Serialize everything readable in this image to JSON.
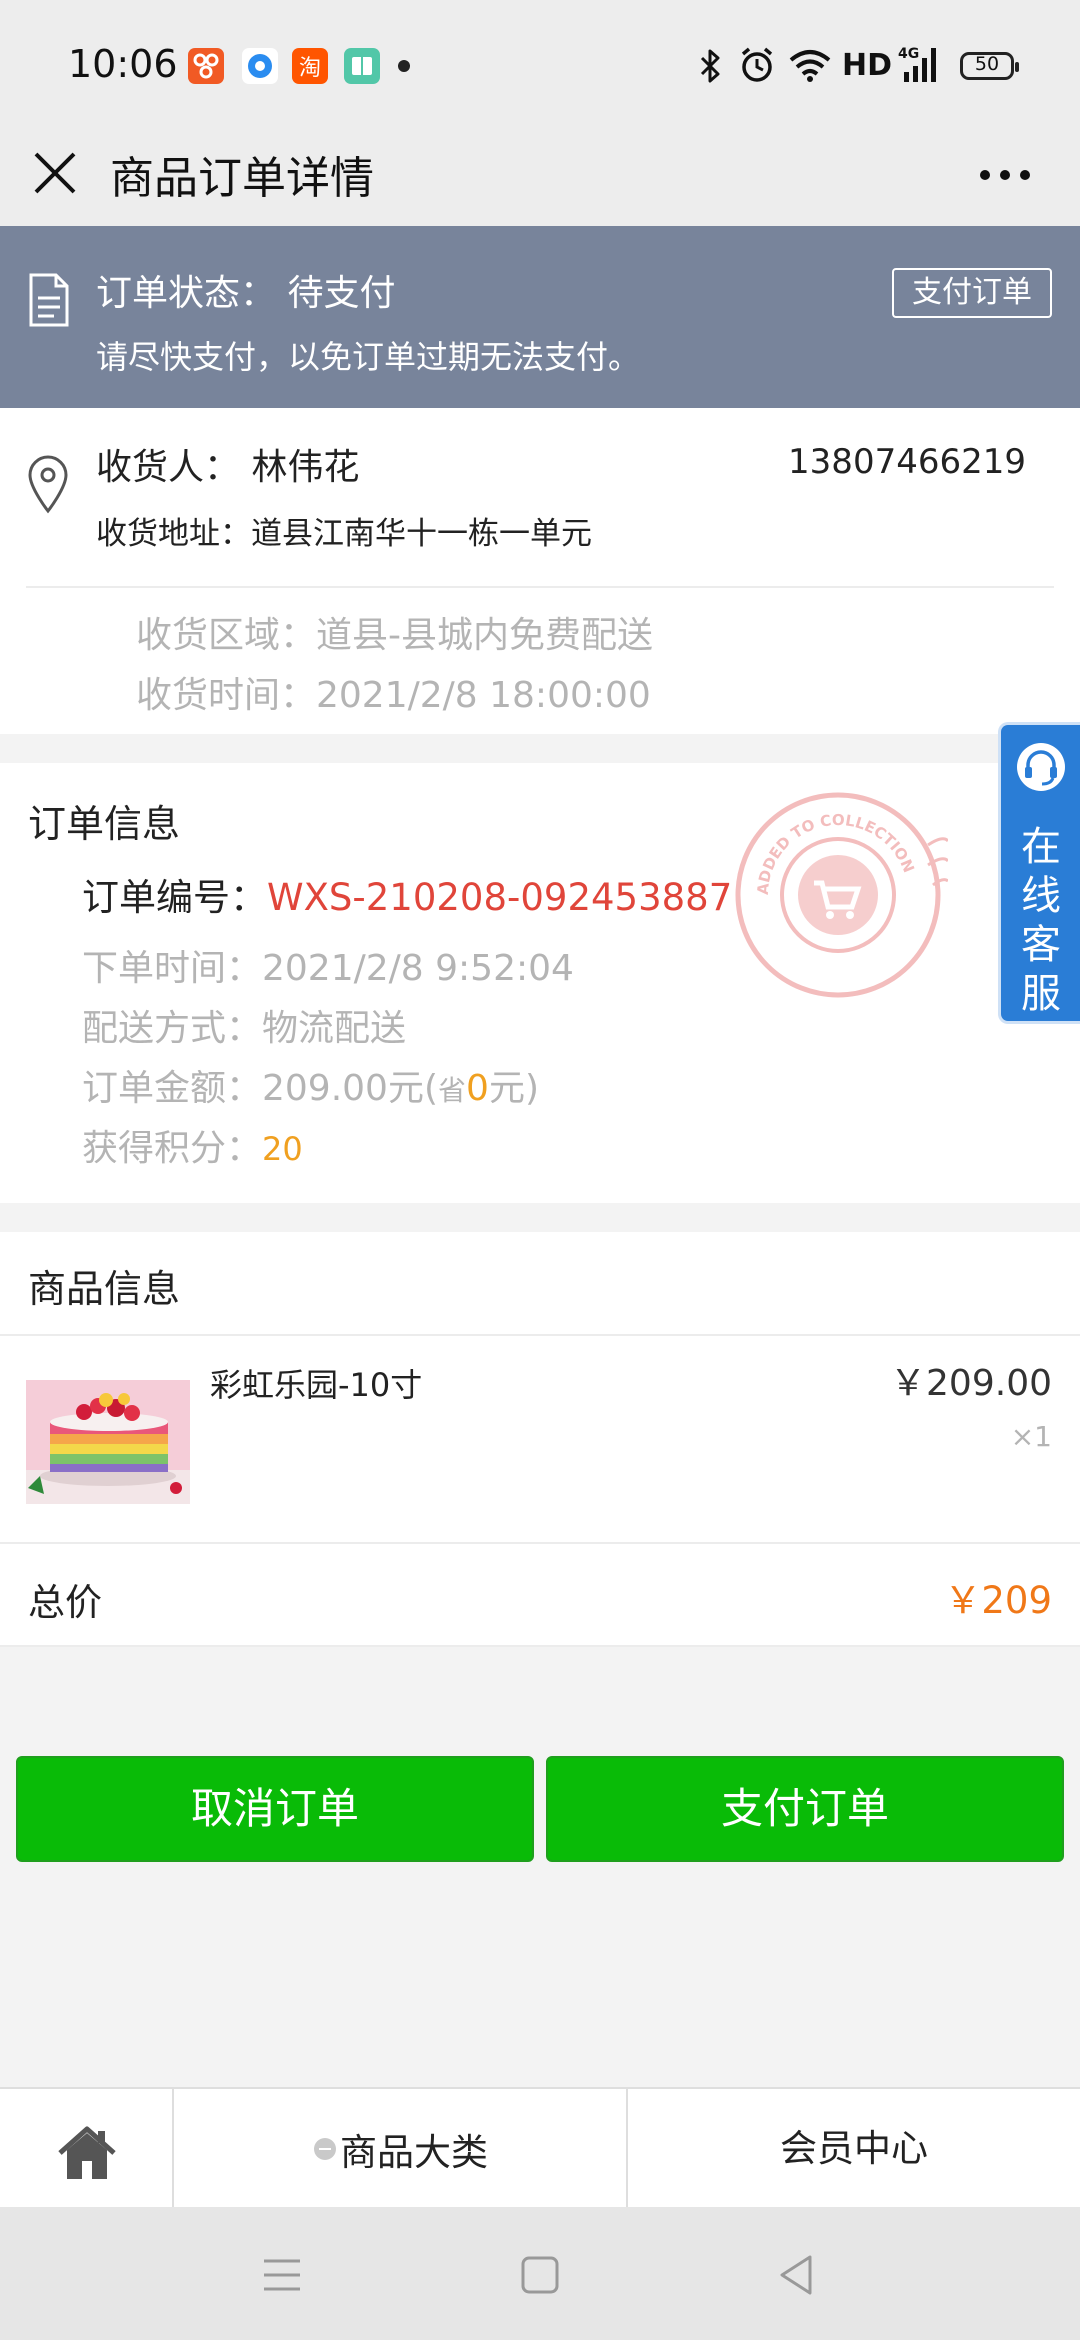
{
  "status_bar": {
    "time": "10:06",
    "network": "HD",
    "battery": "50",
    "icons": [
      "app-icon-red",
      "app-icon-blue",
      "taobao-icon",
      "reader-icon",
      "bluetooth-icon",
      "alarm-icon",
      "wifi-icon",
      "signal-4g-icon"
    ]
  },
  "header": {
    "title": "商品订单详情"
  },
  "order_status": {
    "status": "订单状态： 待支付",
    "tip": "请尽快支付，以免订单过期无法支付。",
    "pay_button": "支付订单"
  },
  "address": {
    "receiver": "收货人： 林伟花",
    "phone": "13807466219",
    "address": "收货地址：道县江南华十一栋一单元",
    "area": "收货区域：道县-县城内免费配送",
    "time": "收货时间：2021/2/8 18:00:00"
  },
  "order_info": {
    "title": "订单信息",
    "number_label": "订单编号：",
    "number": "WXS-210208-092453887",
    "order_time": "下单时间：2021/2/8 9:52:04",
    "delivery": "配送方式：物流配送",
    "amount_prefix": "订单金额：209.00元(",
    "amount_save_label": "省",
    "amount_save_value": "0",
    "amount_suffix": "元)",
    "points_label": "获得积分：",
    "points": "20",
    "stamp_text": "ADDED TO COLLECTION"
  },
  "service": {
    "label": "在线客服"
  },
  "goods": {
    "title": "商品信息",
    "items": [
      {
        "name": "彩虹乐园-10寸",
        "price": "￥209.00",
        "qty": "×1"
      }
    ],
    "total_label": "总价",
    "total_value": "￥209"
  },
  "actions": {
    "cancel": "取消订单",
    "pay": "支付订单"
  },
  "bottom_nav": {
    "category": "商品大类",
    "member": "会员中心"
  },
  "colors": {
    "banner": "#78849b",
    "primary_green": "#09bb07",
    "red": "#e0453a",
    "orange": "#f07818",
    "service_blue": "#2a7dd6"
  }
}
